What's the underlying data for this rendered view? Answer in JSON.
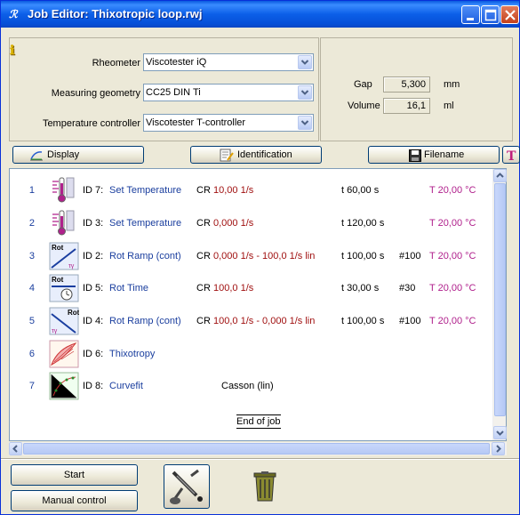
{
  "window": {
    "title": "Job Editor: Thixotropic loop.rwj",
    "app_icon": "rheo-app-icon",
    "controls": [
      "minimize",
      "maximize",
      "close"
    ]
  },
  "settings": {
    "rheometer_label": "Rheometer",
    "rheometer_value": "Viscotester iQ",
    "geometry_label": "Measuring geometry",
    "geometry_value": "CC25 DIN Ti",
    "temp_ctrl_label": "Temperature controller",
    "temp_ctrl_value": "Viscotester T-controller",
    "gap_label": "Gap",
    "gap_value": "5,300",
    "gap_unit": "mm",
    "volume_label": "Volume",
    "volume_value": "16,1",
    "volume_unit": "ml"
  },
  "toolbar": {
    "display_label": "Display",
    "identification_label": "Identification",
    "filename_label": "Filename"
  },
  "job_steps": [
    {
      "num": "1",
      "id": "ID 7:",
      "op": "Set Temperature",
      "mode": "CR",
      "value": "10,00 1/s",
      "time": "t 60,00 s",
      "points": "",
      "temp": "T 20,00 °C",
      "icon": "thermometer-icon"
    },
    {
      "num": "2",
      "id": "ID 3:",
      "op": "Set Temperature",
      "mode": "CR",
      "value": "0,000 1/s",
      "time": "t 120,00 s",
      "points": "",
      "temp": "T 20,00 °C",
      "icon": "thermometer-icon"
    },
    {
      "num": "3",
      "id": "ID 2:",
      "op": "Rot Ramp (cont)",
      "mode": "CR",
      "value": "0,000 1/s - 100,0 1/s lin",
      "time": "t 100,00 s",
      "points": "#100",
      "temp": "T 20,00 °C",
      "icon": "rot-ramp-up-icon"
    },
    {
      "num": "4",
      "id": "ID 5:",
      "op": "Rot Time",
      "mode": "CR",
      "value": "100,0 1/s",
      "time": "t 30,00 s",
      "points": "#30",
      "temp": "T 20,00 °C",
      "icon": "rot-time-icon"
    },
    {
      "num": "5",
      "id": "ID 4:",
      "op": "Rot Ramp (cont)",
      "mode": "CR",
      "value": "100,0 1/s - 0,000 1/s lin",
      "time": "t 100,00 s",
      "points": "#100",
      "temp": "T 20,00 °C",
      "icon": "rot-ramp-down-icon"
    },
    {
      "num": "6",
      "id": "ID 6:",
      "op": "Thixotropy",
      "mode": "",
      "value": "",
      "time": "",
      "points": "",
      "temp": "",
      "icon": "thixotropy-icon"
    },
    {
      "num": "7",
      "id": "ID 8:",
      "op": "Curvefit",
      "mode": "Casson (lin)",
      "value": "",
      "time": "",
      "points": "",
      "temp": "",
      "icon": "curvefit-icon"
    }
  ],
  "end_of_job": "End of job",
  "bottom": {
    "start_label": "Start",
    "manual_label": "Manual control"
  },
  "colors": {
    "title_bar": "#0c5fe8",
    "step_value": "#a01010",
    "temperature": "#b0208c",
    "step_name": "#1a3e9e"
  }
}
